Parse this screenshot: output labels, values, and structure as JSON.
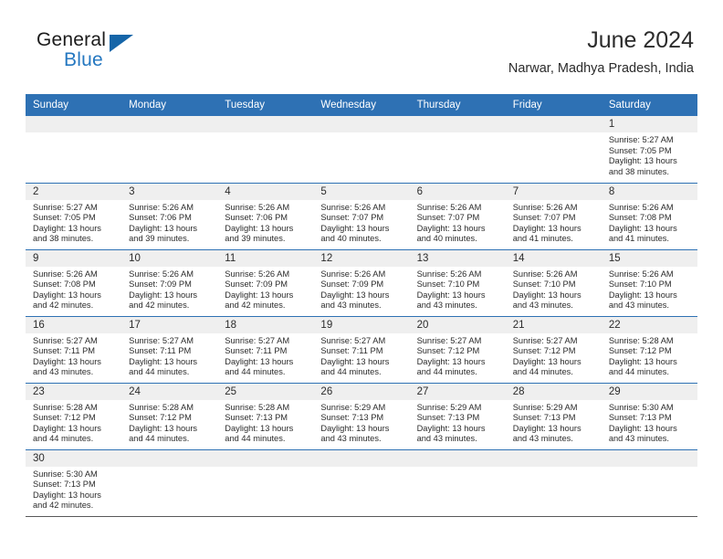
{
  "logo": {
    "word_one": "General",
    "word_two": "Blue",
    "triangle_icon": "triangle-right-icon",
    "triangle_color": "#1565a8"
  },
  "header": {
    "title": "June 2024",
    "subtitle": "Narwar, Madhya Pradesh, India"
  },
  "theme": {
    "header_blue": "#2e71b4",
    "daynum_band": "#efefef",
    "row_separator": "#2e71b4",
    "last_row_separator": "#58585a",
    "text": "#2b2b2b"
  },
  "weekday_headers": [
    "Sunday",
    "Monday",
    "Tuesday",
    "Wednesday",
    "Thursday",
    "Friday",
    "Saturday"
  ],
  "weeks": [
    [
      {
        "empty": true
      },
      {
        "empty": true
      },
      {
        "empty": true
      },
      {
        "empty": true
      },
      {
        "empty": true
      },
      {
        "empty": true
      },
      {
        "day": "1",
        "sunrise": "Sunrise: 5:27 AM",
        "sunset": "Sunset: 7:05 PM",
        "daylight_1": "Daylight: 13 hours",
        "daylight_2": "and 38 minutes."
      }
    ],
    [
      {
        "day": "2",
        "sunrise": "Sunrise: 5:27 AM",
        "sunset": "Sunset: 7:05 PM",
        "daylight_1": "Daylight: 13 hours",
        "daylight_2": "and 38 minutes."
      },
      {
        "day": "3",
        "sunrise": "Sunrise: 5:26 AM",
        "sunset": "Sunset: 7:06 PM",
        "daylight_1": "Daylight: 13 hours",
        "daylight_2": "and 39 minutes."
      },
      {
        "day": "4",
        "sunrise": "Sunrise: 5:26 AM",
        "sunset": "Sunset: 7:06 PM",
        "daylight_1": "Daylight: 13 hours",
        "daylight_2": "and 39 minutes."
      },
      {
        "day": "5",
        "sunrise": "Sunrise: 5:26 AM",
        "sunset": "Sunset: 7:07 PM",
        "daylight_1": "Daylight: 13 hours",
        "daylight_2": "and 40 minutes."
      },
      {
        "day": "6",
        "sunrise": "Sunrise: 5:26 AM",
        "sunset": "Sunset: 7:07 PM",
        "daylight_1": "Daylight: 13 hours",
        "daylight_2": "and 40 minutes."
      },
      {
        "day": "7",
        "sunrise": "Sunrise: 5:26 AM",
        "sunset": "Sunset: 7:07 PM",
        "daylight_1": "Daylight: 13 hours",
        "daylight_2": "and 41 minutes."
      },
      {
        "day": "8",
        "sunrise": "Sunrise: 5:26 AM",
        "sunset": "Sunset: 7:08 PM",
        "daylight_1": "Daylight: 13 hours",
        "daylight_2": "and 41 minutes."
      }
    ],
    [
      {
        "day": "9",
        "sunrise": "Sunrise: 5:26 AM",
        "sunset": "Sunset: 7:08 PM",
        "daylight_1": "Daylight: 13 hours",
        "daylight_2": "and 42 minutes."
      },
      {
        "day": "10",
        "sunrise": "Sunrise: 5:26 AM",
        "sunset": "Sunset: 7:09 PM",
        "daylight_1": "Daylight: 13 hours",
        "daylight_2": "and 42 minutes."
      },
      {
        "day": "11",
        "sunrise": "Sunrise: 5:26 AM",
        "sunset": "Sunset: 7:09 PM",
        "daylight_1": "Daylight: 13 hours",
        "daylight_2": "and 42 minutes."
      },
      {
        "day": "12",
        "sunrise": "Sunrise: 5:26 AM",
        "sunset": "Sunset: 7:09 PM",
        "daylight_1": "Daylight: 13 hours",
        "daylight_2": "and 43 minutes."
      },
      {
        "day": "13",
        "sunrise": "Sunrise: 5:26 AM",
        "sunset": "Sunset: 7:10 PM",
        "daylight_1": "Daylight: 13 hours",
        "daylight_2": "and 43 minutes."
      },
      {
        "day": "14",
        "sunrise": "Sunrise: 5:26 AM",
        "sunset": "Sunset: 7:10 PM",
        "daylight_1": "Daylight: 13 hours",
        "daylight_2": "and 43 minutes."
      },
      {
        "day": "15",
        "sunrise": "Sunrise: 5:26 AM",
        "sunset": "Sunset: 7:10 PM",
        "daylight_1": "Daylight: 13 hours",
        "daylight_2": "and 43 minutes."
      }
    ],
    [
      {
        "day": "16",
        "sunrise": "Sunrise: 5:27 AM",
        "sunset": "Sunset: 7:11 PM",
        "daylight_1": "Daylight: 13 hours",
        "daylight_2": "and 43 minutes."
      },
      {
        "day": "17",
        "sunrise": "Sunrise: 5:27 AM",
        "sunset": "Sunset: 7:11 PM",
        "daylight_1": "Daylight: 13 hours",
        "daylight_2": "and 44 minutes."
      },
      {
        "day": "18",
        "sunrise": "Sunrise: 5:27 AM",
        "sunset": "Sunset: 7:11 PM",
        "daylight_1": "Daylight: 13 hours",
        "daylight_2": "and 44 minutes."
      },
      {
        "day": "19",
        "sunrise": "Sunrise: 5:27 AM",
        "sunset": "Sunset: 7:11 PM",
        "daylight_1": "Daylight: 13 hours",
        "daylight_2": "and 44 minutes."
      },
      {
        "day": "20",
        "sunrise": "Sunrise: 5:27 AM",
        "sunset": "Sunset: 7:12 PM",
        "daylight_1": "Daylight: 13 hours",
        "daylight_2": "and 44 minutes."
      },
      {
        "day": "21",
        "sunrise": "Sunrise: 5:27 AM",
        "sunset": "Sunset: 7:12 PM",
        "daylight_1": "Daylight: 13 hours",
        "daylight_2": "and 44 minutes."
      },
      {
        "day": "22",
        "sunrise": "Sunrise: 5:28 AM",
        "sunset": "Sunset: 7:12 PM",
        "daylight_1": "Daylight: 13 hours",
        "daylight_2": "and 44 minutes."
      }
    ],
    [
      {
        "day": "23",
        "sunrise": "Sunrise: 5:28 AM",
        "sunset": "Sunset: 7:12 PM",
        "daylight_1": "Daylight: 13 hours",
        "daylight_2": "and 44 minutes."
      },
      {
        "day": "24",
        "sunrise": "Sunrise: 5:28 AM",
        "sunset": "Sunset: 7:12 PM",
        "daylight_1": "Daylight: 13 hours",
        "daylight_2": "and 44 minutes."
      },
      {
        "day": "25",
        "sunrise": "Sunrise: 5:28 AM",
        "sunset": "Sunset: 7:13 PM",
        "daylight_1": "Daylight: 13 hours",
        "daylight_2": "and 44 minutes."
      },
      {
        "day": "26",
        "sunrise": "Sunrise: 5:29 AM",
        "sunset": "Sunset: 7:13 PM",
        "daylight_1": "Daylight: 13 hours",
        "daylight_2": "and 43 minutes."
      },
      {
        "day": "27",
        "sunrise": "Sunrise: 5:29 AM",
        "sunset": "Sunset: 7:13 PM",
        "daylight_1": "Daylight: 13 hours",
        "daylight_2": "and 43 minutes."
      },
      {
        "day": "28",
        "sunrise": "Sunrise: 5:29 AM",
        "sunset": "Sunset: 7:13 PM",
        "daylight_1": "Daylight: 13 hours",
        "daylight_2": "and 43 minutes."
      },
      {
        "day": "29",
        "sunrise": "Sunrise: 5:30 AM",
        "sunset": "Sunset: 7:13 PM",
        "daylight_1": "Daylight: 13 hours",
        "daylight_2": "and 43 minutes."
      }
    ],
    [
      {
        "day": "30",
        "sunrise": "Sunrise: 5:30 AM",
        "sunset": "Sunset: 7:13 PM",
        "daylight_1": "Daylight: 13 hours",
        "daylight_2": "and 42 minutes."
      },
      {
        "empty": true
      },
      {
        "empty": true
      },
      {
        "empty": true
      },
      {
        "empty": true
      },
      {
        "empty": true
      },
      {
        "empty": true
      }
    ]
  ]
}
